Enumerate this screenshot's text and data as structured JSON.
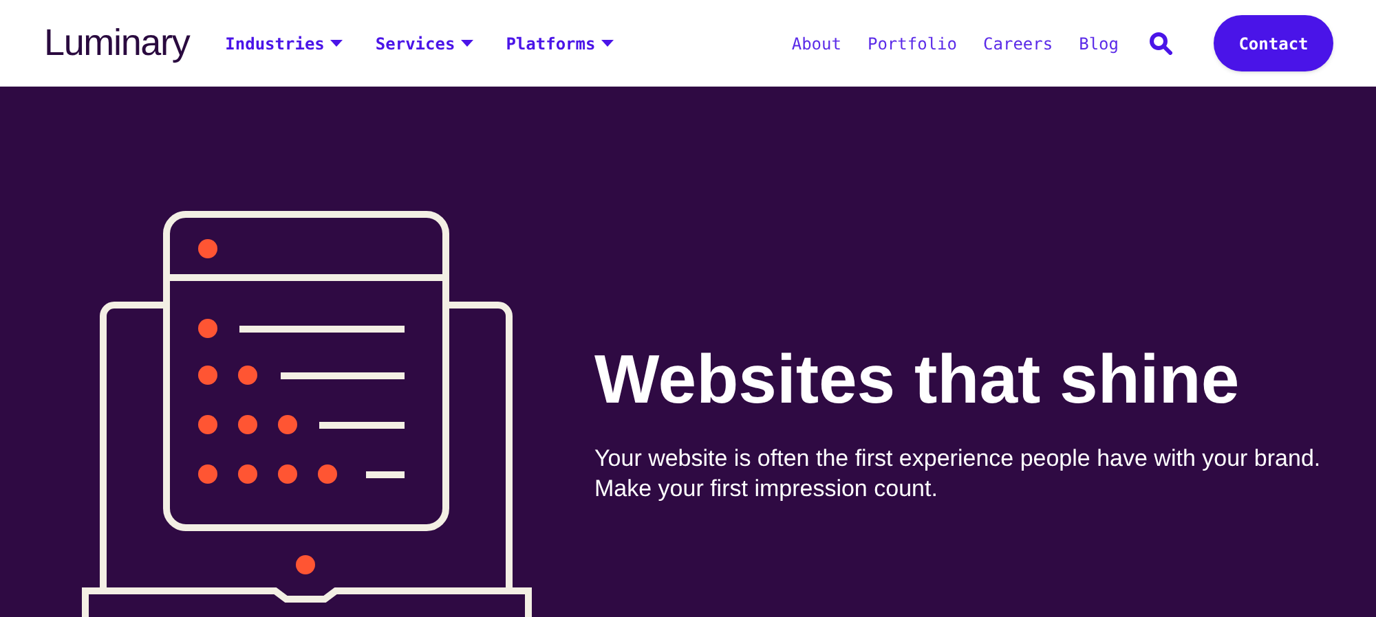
{
  "header": {
    "logo": "Luminary",
    "nav": [
      {
        "label": "Industries",
        "kind": "dropdown"
      },
      {
        "label": "Services",
        "kind": "dropdown"
      },
      {
        "label": "Platforms",
        "kind": "dropdown"
      },
      {
        "label": "About",
        "kind": "link"
      },
      {
        "label": "Portfolio",
        "kind": "link"
      },
      {
        "label": "Careers",
        "kind": "link"
      },
      {
        "label": "Blog",
        "kind": "link"
      }
    ],
    "cta": "Contact"
  },
  "hero": {
    "title": "Websites that shine",
    "text": "Your website is often the first experience people have with your brand. Make your first impression count."
  }
}
